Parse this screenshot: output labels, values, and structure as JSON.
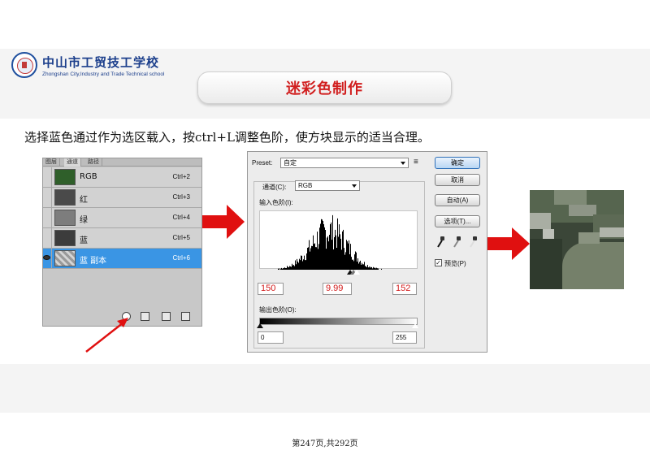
{
  "header": {
    "logo_cn": "中山市工贸技工学校",
    "logo_en": "Zhongshan City,Industry and Trade Technical school",
    "title": "迷彩色制作"
  },
  "instruction": "选择蓝色通过作为选区载入，按ctrl+L调整色阶，使方块显示的适当合理。",
  "channels_panel": {
    "tabs": [
      "图层",
      "通道",
      "路径"
    ],
    "rows": [
      {
        "name": "RGB",
        "shortcut": "Ctrl+2",
        "thumb_color": "#2f5f2a",
        "selected": false
      },
      {
        "name": "红",
        "shortcut": "Ctrl+3",
        "thumb_color": "#4a4a4a",
        "selected": false
      },
      {
        "name": "绿",
        "shortcut": "Ctrl+4",
        "thumb_color": "#7d7d7d",
        "selected": false
      },
      {
        "name": "蓝",
        "shortcut": "Ctrl+5",
        "thumb_color": "#3c3c3c",
        "selected": false
      },
      {
        "name": "蓝 副本",
        "shortcut": "Ctrl+6",
        "thumb_color": "#b5b5b5",
        "selected": true
      }
    ]
  },
  "levels_dialog": {
    "preset_label": "Preset:",
    "preset_value": "自定",
    "channel_label": "通道(C):",
    "channel_value": "RGB",
    "input_levels_label": "输入色阶(I):",
    "input_values": {
      "black": "150",
      "gamma": "9.99",
      "white": "152"
    },
    "output_levels_label": "输出色阶(O):",
    "output_values": {
      "black": "0",
      "white": "255"
    },
    "buttons": {
      "ok": "确定",
      "cancel": "取消",
      "auto": "自动(A)",
      "options": "选项(T)..."
    },
    "preview_label": "预览(P)",
    "preview_checked": true
  },
  "colors": {
    "accent_red": "#e01010",
    "selection_blue": "#3a95e4",
    "title_red": "#d11f1f"
  },
  "footer": "第247页,共292页"
}
